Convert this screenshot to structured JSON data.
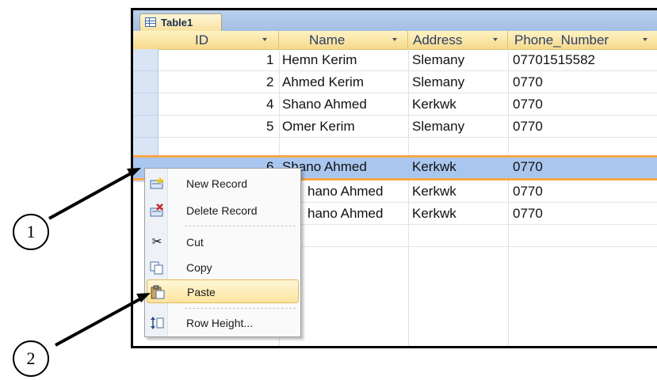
{
  "tab": {
    "label": "Table1"
  },
  "columns": [
    {
      "label": "ID"
    },
    {
      "label": "Name"
    },
    {
      "label": "Address"
    },
    {
      "label": "Phone_Number"
    }
  ],
  "rows": [
    {
      "id": "1",
      "name": "Hemn Kerim",
      "address": "Slemany",
      "phone": "07701515582"
    },
    {
      "id": "2",
      "name": "Ahmed Kerim",
      "address": "Slemany",
      "phone": "0770"
    },
    {
      "id": "4",
      "name": "Shano Ahmed",
      "address": "Kerkwk",
      "phone": "0770"
    },
    {
      "id": "5",
      "name": "Omer Kerim",
      "address": "Slemany",
      "phone": "0770"
    },
    {
      "id": "6",
      "name": "Shano Ahmed",
      "address": "Kerkwk",
      "phone": "0770"
    },
    {
      "id": "",
      "name": "hano Ahmed",
      "address": "Kerkwk",
      "phone": "0770"
    },
    {
      "id": "",
      "name": "hano Ahmed",
      "address": "Kerkwk",
      "phone": "0770"
    }
  ],
  "context_menu": [
    {
      "label": "New Record",
      "icon": "new-record-icon"
    },
    {
      "label": "Delete Record",
      "icon": "delete-record-icon"
    },
    {
      "label": "Cut",
      "icon": "scissors-icon"
    },
    {
      "label": "Copy",
      "icon": "copy-icon"
    },
    {
      "label": "Paste",
      "icon": "paste-icon"
    },
    {
      "label": "Row Height...",
      "icon": "row-height-icon"
    }
  ],
  "callouts": {
    "one": "1",
    "two": "2"
  },
  "colors": {
    "header_bg": "#f6d98a",
    "selected_row": "#a9c6ee",
    "selection_border": "#f7a64a",
    "menu_highlight": "#fde4a0"
  }
}
